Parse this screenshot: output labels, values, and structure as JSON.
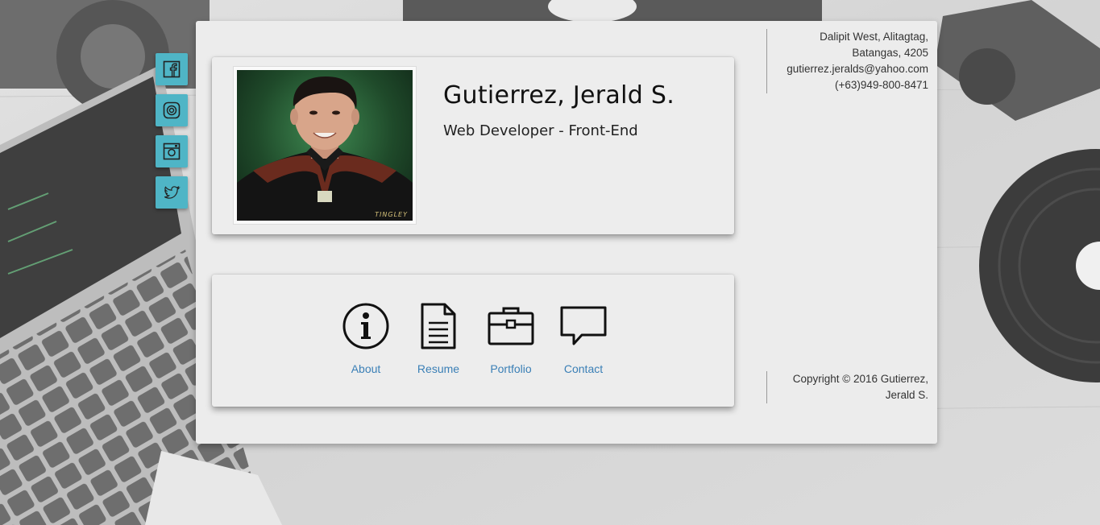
{
  "social": {
    "items": [
      {
        "name": "facebook",
        "icon": "facebook-icon"
      },
      {
        "name": "threads",
        "icon": "spiral-icon"
      },
      {
        "name": "instagram",
        "icon": "instagram-icon"
      },
      {
        "name": "twitter",
        "icon": "twitter-icon"
      }
    ],
    "accent_color": "#4fb5c6"
  },
  "profile": {
    "name": "Gutierrez, Jerald S.",
    "role": "Web Developer - Front-End",
    "photo_watermark": "TINGLEY"
  },
  "nav": {
    "items": [
      {
        "label": "About",
        "icon": "info-icon"
      },
      {
        "label": "Resume",
        "icon": "document-icon"
      },
      {
        "label": "Portfolio",
        "icon": "briefcase-icon"
      },
      {
        "label": "Contact",
        "icon": "speech-bubble-icon"
      }
    ],
    "link_color": "#3a7fb6"
  },
  "contact": {
    "address_line1": "Dalipit West, Alitagtag,",
    "address_line2": "Batangas, 4205",
    "email": "gutierrez.jeralds@yahoo.com",
    "phone": "(+63)949-800-8471"
  },
  "footer": {
    "copyright_line1": "Copyright © 2016 Gutierrez,",
    "copyright_line2": "Jerald S."
  }
}
